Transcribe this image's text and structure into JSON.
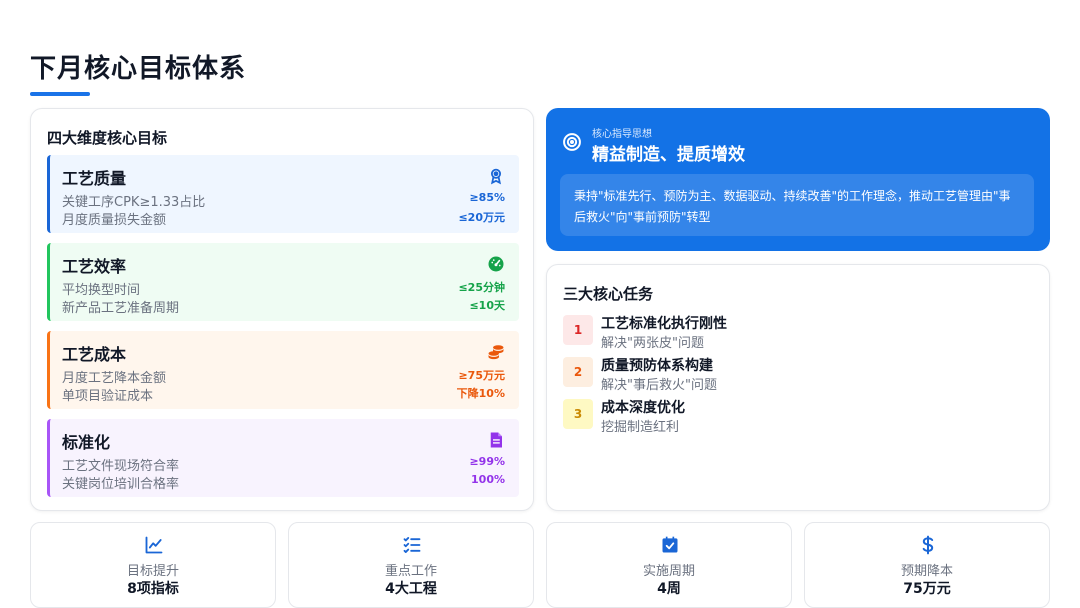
{
  "page": {
    "title": "下月核心目标体系"
  },
  "goals": {
    "heading": "四大维度核心目标",
    "items": [
      {
        "title": "工艺质量",
        "icon": "award-icon",
        "color": "#1a66d6",
        "bg": "#eff6ff",
        "border": "#1a66d6",
        "metrics": [
          {
            "label": "关键工序CPK≥1.33占比",
            "value": "≥85%"
          },
          {
            "label": "月度质量损失金额",
            "value": "≤20万元"
          }
        ]
      },
      {
        "title": "工艺效率",
        "icon": "speedometer-icon",
        "color": "#16a34a",
        "bg": "#effcf3",
        "border": "#22c55e",
        "metrics": [
          {
            "label": "平均换型时间",
            "value": "≤25分钟"
          },
          {
            "label": "新产品工艺准备周期",
            "value": "≤10天"
          }
        ]
      },
      {
        "title": "工艺成本",
        "icon": "coins-icon",
        "color": "#ea580c",
        "bg": "#fff6ed",
        "border": "#f97316",
        "metrics": [
          {
            "label": "月度工艺降本金额",
            "value": "≥75万元"
          },
          {
            "label": "单项目验证成本",
            "value": "下降10%"
          }
        ]
      },
      {
        "title": "标准化",
        "icon": "document-icon",
        "color": "#9333ea",
        "bg": "#f8f3fe",
        "border": "#a855f7",
        "metrics": [
          {
            "label": "工艺文件现场符合率",
            "value": "≥99%"
          },
          {
            "label": "关键岗位培训合格率",
            "value": "100%"
          }
        ]
      }
    ]
  },
  "guide": {
    "icon": "target-icon",
    "subtitle": "核心指导思想",
    "title": "精益制造、提质增效",
    "body": "秉持\"标准先行、预防为主、数据驱动、持续改善\"的工作理念，推动工艺管理由\"事后救火\"向\"事前预防\"转型"
  },
  "tasks": {
    "heading": "三大核心任务",
    "items": [
      {
        "num": "1",
        "title": "工艺标准化执行刚性",
        "desc": "解决\"两张皮\"问题",
        "color": "#dc2626",
        "bg": "#fde8e8"
      },
      {
        "num": "2",
        "title": "质量预防体系构建",
        "desc": "解决\"事后救火\"问题",
        "color": "#ea580c",
        "bg": "#fdeee0"
      },
      {
        "num": "3",
        "title": "成本深度优化",
        "desc": "挖掘制造红利",
        "color": "#ca8a04",
        "bg": "#fef9c3"
      }
    ]
  },
  "stats": [
    {
      "icon": "line-chart-icon",
      "label": "目标提升",
      "value": "8项指标"
    },
    {
      "icon": "checklist-icon",
      "label": "重点工作",
      "value": "4大工程"
    },
    {
      "icon": "calendar-check-icon",
      "label": "实施周期",
      "value": "4周"
    },
    {
      "icon": "dollar-icon",
      "label": "预期降本",
      "value": "75万元"
    }
  ],
  "colors": {
    "accent": "#1a73e8",
    "guide_bg": "#1372e6"
  }
}
